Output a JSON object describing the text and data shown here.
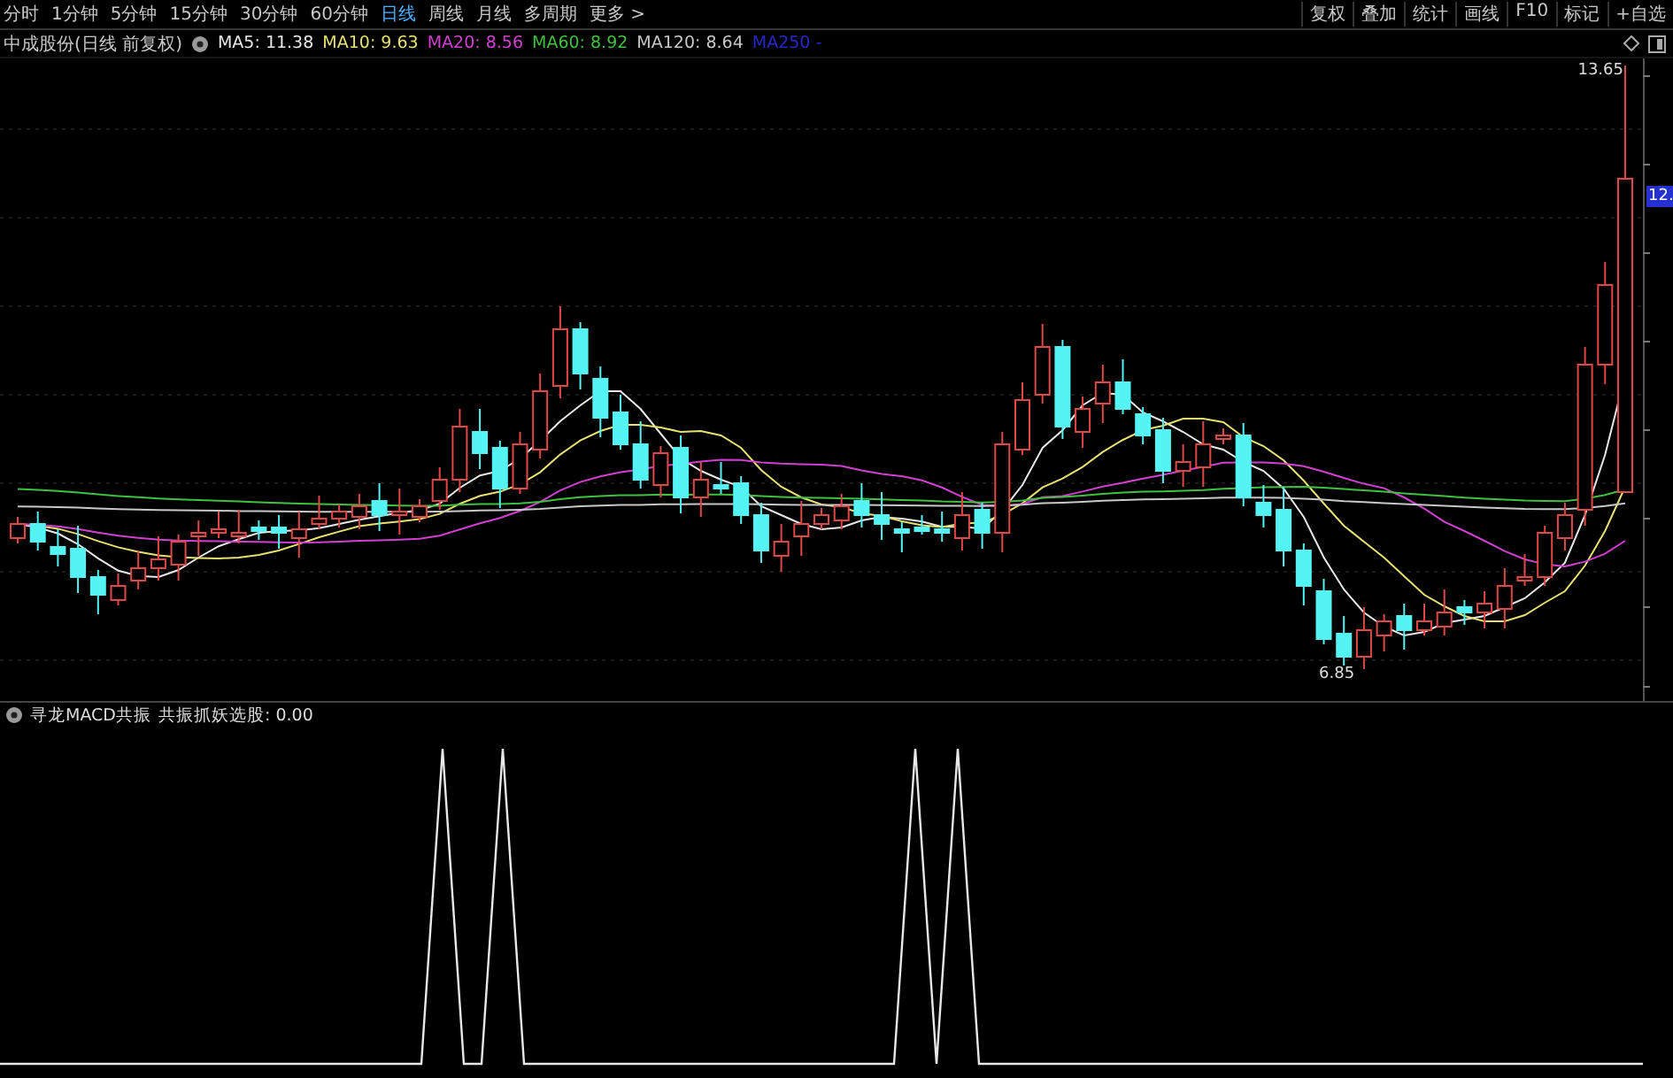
{
  "toolbar": {
    "periods": [
      {
        "label": "分时",
        "selected": false
      },
      {
        "label": "1分钟",
        "selected": false
      },
      {
        "label": "5分钟",
        "selected": false
      },
      {
        "label": "15分钟",
        "selected": false
      },
      {
        "label": "30分钟",
        "selected": false
      },
      {
        "label": "60分钟",
        "selected": false
      },
      {
        "label": "日线",
        "selected": true
      },
      {
        "label": "周线",
        "selected": false
      },
      {
        "label": "月线",
        "selected": false
      },
      {
        "label": "多周期",
        "selected": false
      },
      {
        "label": "更多 >",
        "selected": false
      }
    ],
    "actions": [
      "复权",
      "叠加",
      "统计",
      "画线",
      "F10",
      "标记",
      "+自选"
    ]
  },
  "main_chart": {
    "title": "中成股份(日线 前复权)",
    "ma_legend": [
      {
        "label": "MA5: 11.38",
        "color": "#e8e8e8"
      },
      {
        "label": "MA10: 9.63",
        "color": "#e8e070"
      },
      {
        "label": "MA20: 8.56",
        "color": "#d040d0"
      },
      {
        "label": "MA60: 8.92",
        "color": "#40c040"
      },
      {
        "label": "MA120: 8.64",
        "color": "#c8c8c8"
      },
      {
        "label": "MA250 -",
        "color": "#2828c8"
      }
    ],
    "high_label": "13.65",
    "low_label": "6.85",
    "price_tag": "12."
  },
  "indicator": {
    "title": "寻龙MACD共振",
    "value": "共振抓妖选股: 0.00"
  }
}
